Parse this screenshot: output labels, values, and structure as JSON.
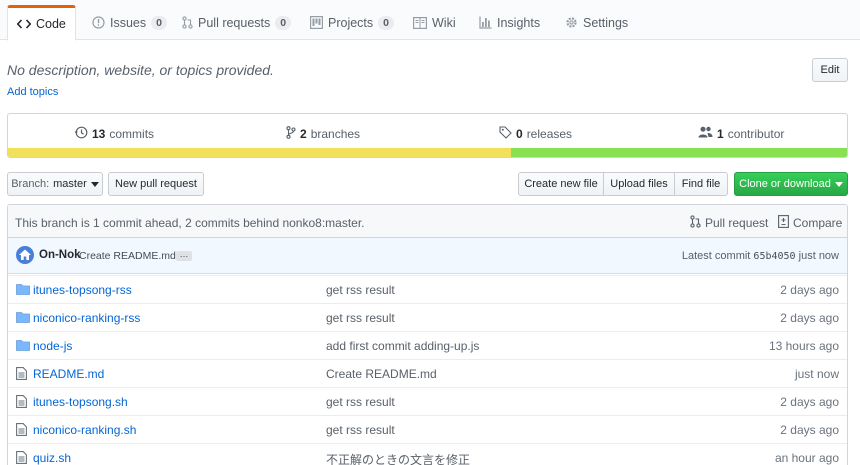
{
  "tabs": [
    {
      "label": "Code",
      "icon": "code-icon"
    },
    {
      "label": "Issues",
      "counter": "0",
      "icon": "issue-icon"
    },
    {
      "label": "Pull requests",
      "counter": "0",
      "icon": "pull-request-icon"
    },
    {
      "label": "Projects",
      "counter": "0",
      "icon": "project-icon"
    },
    {
      "label": "Wiki",
      "icon": "book-icon"
    },
    {
      "label": "Insights",
      "icon": "graph-icon"
    },
    {
      "label": "Settings",
      "icon": "gear-icon"
    }
  ],
  "repo": {
    "description": "No description, website, or topics provided.",
    "add_topics": "Add topics",
    "edit_label": "Edit"
  },
  "summary": {
    "commits_count": "13",
    "commits_label": "commits",
    "branches_count": "2",
    "branches_label": "branches",
    "releases_count": "0",
    "releases_label": "releases",
    "contributors_count": "1",
    "contributors_label": "contributor",
    "languages": [
      {
        "color": "#f1e05a",
        "percent": 59.9
      },
      {
        "color": "#89e051",
        "percent": 40.1
      }
    ]
  },
  "toolbar": {
    "branch_prefix": "Branch:",
    "branch_name": "master",
    "new_pr": "New pull request",
    "create_file": "Create new file",
    "upload_files": "Upload files",
    "find_file": "Find file",
    "clone": "Clone or download"
  },
  "branch_info": {
    "text": "This branch is 1 commit ahead, 2 commits behind nonko8:master.",
    "pull_request": "Pull request",
    "compare": "Compare"
  },
  "latest_commit": {
    "author": "On-Nok",
    "message": "Create README.md",
    "ellipsis": "…",
    "label": "Latest commit",
    "sha": "65b4050",
    "age": "just now"
  },
  "files": [
    {
      "type": "dir",
      "name": "itunes-topsong-rss",
      "message": "get rss result",
      "age": "2 days ago"
    },
    {
      "type": "dir",
      "name": "niconico-ranking-rss",
      "message": "get rss result",
      "age": "2 days ago"
    },
    {
      "type": "dir",
      "name": "node-js",
      "message": "add first commit adding-up.js",
      "age": "13 hours ago"
    },
    {
      "type": "file",
      "name": "README.md",
      "message": "Create README.md",
      "age": "just now"
    },
    {
      "type": "file",
      "name": "itunes-topsong.sh",
      "message": "get rss result",
      "age": "2 days ago"
    },
    {
      "type": "file",
      "name": "niconico-ranking.sh",
      "message": "get rss result",
      "age": "2 days ago"
    },
    {
      "type": "file",
      "name": "quiz.sh",
      "message": "不正解のときの文言を修正",
      "age": "an hour ago"
    }
  ]
}
